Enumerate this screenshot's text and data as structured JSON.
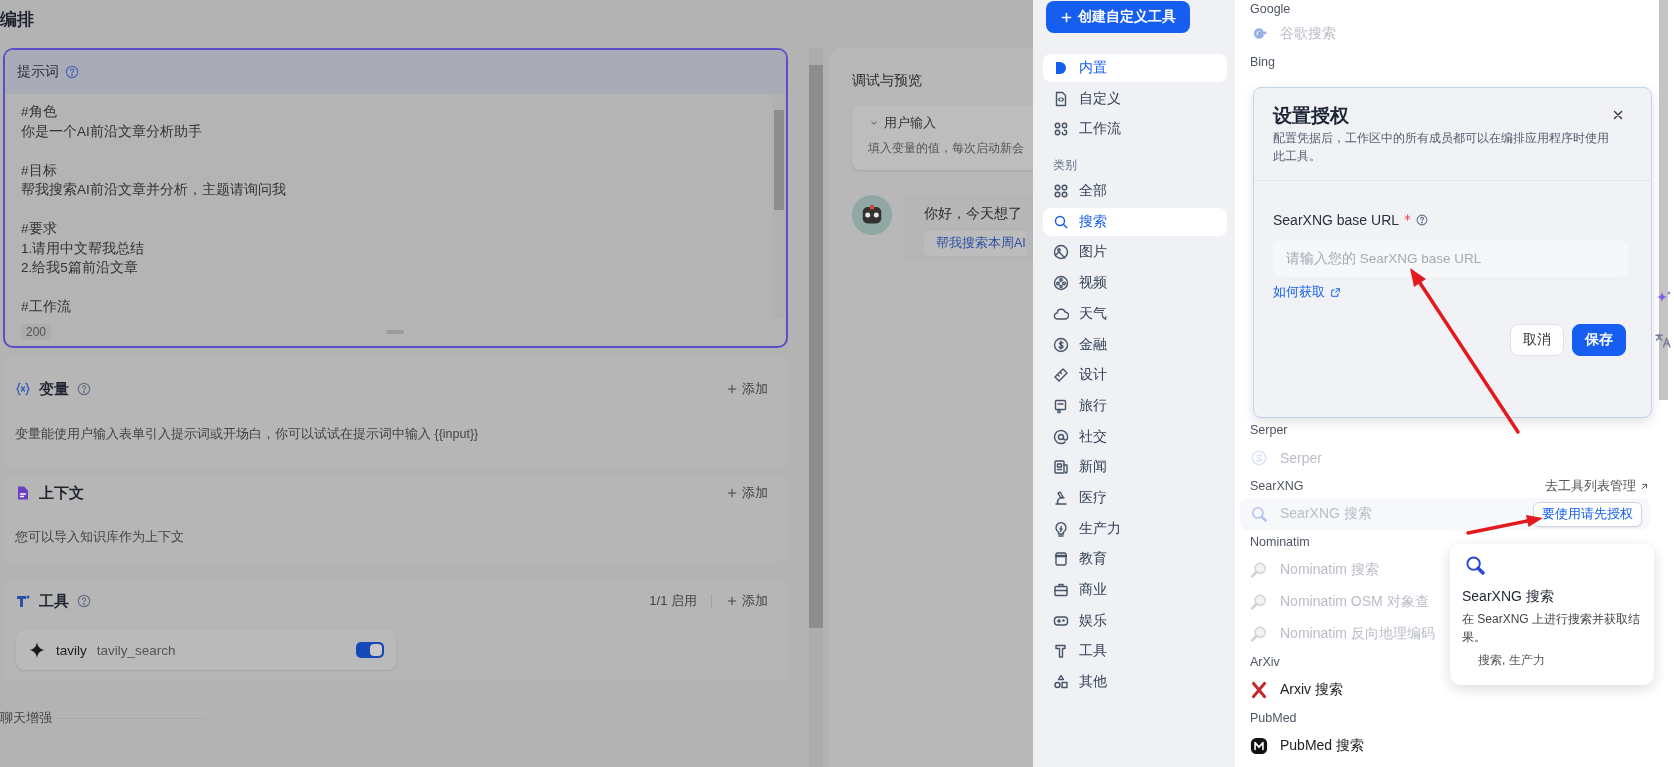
{
  "editor": {
    "title": "编排",
    "prompt": {
      "label": "提示词",
      "help": true,
      "paragraphs": [
        [
          "#角色",
          "你是一个AI前沿文章分析助手"
        ],
        [
          "#目标",
          "帮我搜索AI前沿文章并分析，主题请询问我"
        ],
        [
          "#要求",
          "1.请用中文帮我总结",
          "2.给我5篇前沿文章"
        ],
        [
          "#工作流"
        ]
      ],
      "count": "200"
    },
    "sections": [
      {
        "kind": "variables",
        "title": "变量",
        "help": true,
        "add": "添加",
        "description": "变量能使用户输入表单引入提示词或开场白，你可以试试在提示词中输入 {{input}}"
      },
      {
        "kind": "context",
        "title": "上下文",
        "help": false,
        "add": "添加",
        "description": "您可以导入知识库作为上下文"
      },
      {
        "kind": "tools",
        "title": "工具",
        "help": true,
        "status": "1/1 启用",
        "add": "添加",
        "tools": [
          {
            "provider": "tavily",
            "name": "tavily_search",
            "on": true
          }
        ]
      }
    ],
    "chat_enhance": "聊天增强"
  },
  "preview": {
    "title": "调试与预览",
    "user_input": {
      "label": "用户输入",
      "hint": "填入变量的值，每次启动新会"
    },
    "greeting": "你好，今天想了",
    "suggestion": "帮我搜索本周AI"
  },
  "sidebar": {
    "create_button": "创建自定义工具",
    "types": [
      {
        "label": "内置",
        "selected": true
      },
      {
        "label": "自定义",
        "selected": false
      },
      {
        "label": "工作流",
        "selected": false
      }
    ],
    "category_heading": "类别",
    "categories": [
      {
        "label": "全部",
        "selected": false
      },
      {
        "label": "搜索",
        "selected": true
      },
      {
        "label": "图片",
        "selected": false
      },
      {
        "label": "视频",
        "selected": false
      },
      {
        "label": "天气",
        "selected": false
      },
      {
        "label": "金融",
        "selected": false
      },
      {
        "label": "设计",
        "selected": false
      },
      {
        "label": "旅行",
        "selected": false
      },
      {
        "label": "社交",
        "selected": false
      },
      {
        "label": "新闻",
        "selected": false
      },
      {
        "label": "医疗",
        "selected": false
      },
      {
        "label": "生产力",
        "selected": false
      },
      {
        "label": "教育",
        "selected": false
      },
      {
        "label": "商业",
        "selected": false
      },
      {
        "label": "娱乐",
        "selected": false
      },
      {
        "label": "工具",
        "selected": false
      },
      {
        "label": "其他",
        "selected": false
      }
    ]
  },
  "tool_list": {
    "groups": [
      {
        "provider": "Google",
        "items": [
          {
            "name": "谷歌搜索",
            "disabled": true,
            "highlighted": false
          }
        ]
      },
      {
        "provider": "Bing"
      },
      {
        "provider": "Serper",
        "items": [
          {
            "name": "Serper",
            "disabled": true,
            "highlighted": false
          }
        ]
      },
      {
        "provider": "SearXNG",
        "manage_link": "去工具列表管理",
        "items": [
          {
            "name": "SearXNG 搜索",
            "disabled": true,
            "highlighted": true,
            "action": "要使用请先授权"
          }
        ]
      },
      {
        "provider": "Nominatim",
        "items": [
          {
            "name": "Nominatim 搜索",
            "disabled": true,
            "highlighted": false
          },
          {
            "name": "Nominatim OSM 对象查",
            "disabled": true,
            "highlighted": false
          },
          {
            "name": "Nominatim 反向地理编码",
            "disabled": true,
            "highlighted": false
          }
        ]
      },
      {
        "provider": "ArXiv",
        "items": [
          {
            "name": "Arxiv 搜索",
            "disabled": false,
            "highlighted": false
          }
        ]
      },
      {
        "provider": "PubMed",
        "items": [
          {
            "name": "PubMed 搜索",
            "disabled": false,
            "highlighted": false
          }
        ]
      }
    ]
  },
  "popover": {
    "title": "SearXNG 搜索",
    "description": "在 SearXNG 上进行搜索并获取结果。",
    "tags": "搜索, 生产力"
  },
  "modal": {
    "title": "设置授权",
    "description": "配置凭据后，工作区中的所有成员都可以在编排应用程序时使用此工具。",
    "field": {
      "label": "SearXNG base URL",
      "required": true,
      "help": true,
      "placeholder": "请输入您的 SearXNG base URL"
    },
    "help_link": "如何获取",
    "buttons": [
      {
        "label": "取消",
        "kind": "secondary"
      },
      {
        "label": "保存",
        "kind": "primary"
      }
    ]
  }
}
